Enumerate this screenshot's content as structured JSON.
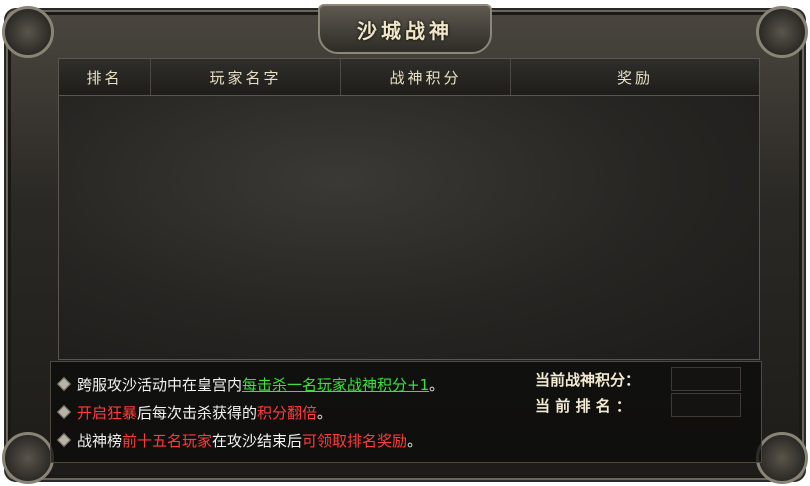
{
  "window": {
    "title": "沙城战神"
  },
  "table": {
    "headers": [
      "排名",
      "玩家名字",
      "战神积分",
      "奖励"
    ]
  },
  "info": {
    "line1": {
      "prefix": "跨服攻沙活动中在皇宫内",
      "highlight": "每击杀一名玩家战神积分+1",
      "suffix": "。"
    },
    "line2": {
      "highlight1": "开启狂暴",
      "middle": "后每次击杀获得的",
      "highlight2": "积分翻倍",
      "suffix": "。"
    },
    "line3": {
      "prefix": "战神榜",
      "highlight1": "前十五名玩家",
      "middle": "在攻沙结束后",
      "highlight2": "可领取排名奖励",
      "suffix": "。"
    }
  },
  "stats": {
    "score_label": "当前战神积分：",
    "score_value": "",
    "rank_label": "当 前 排 名 ：",
    "rank_value": ""
  }
}
